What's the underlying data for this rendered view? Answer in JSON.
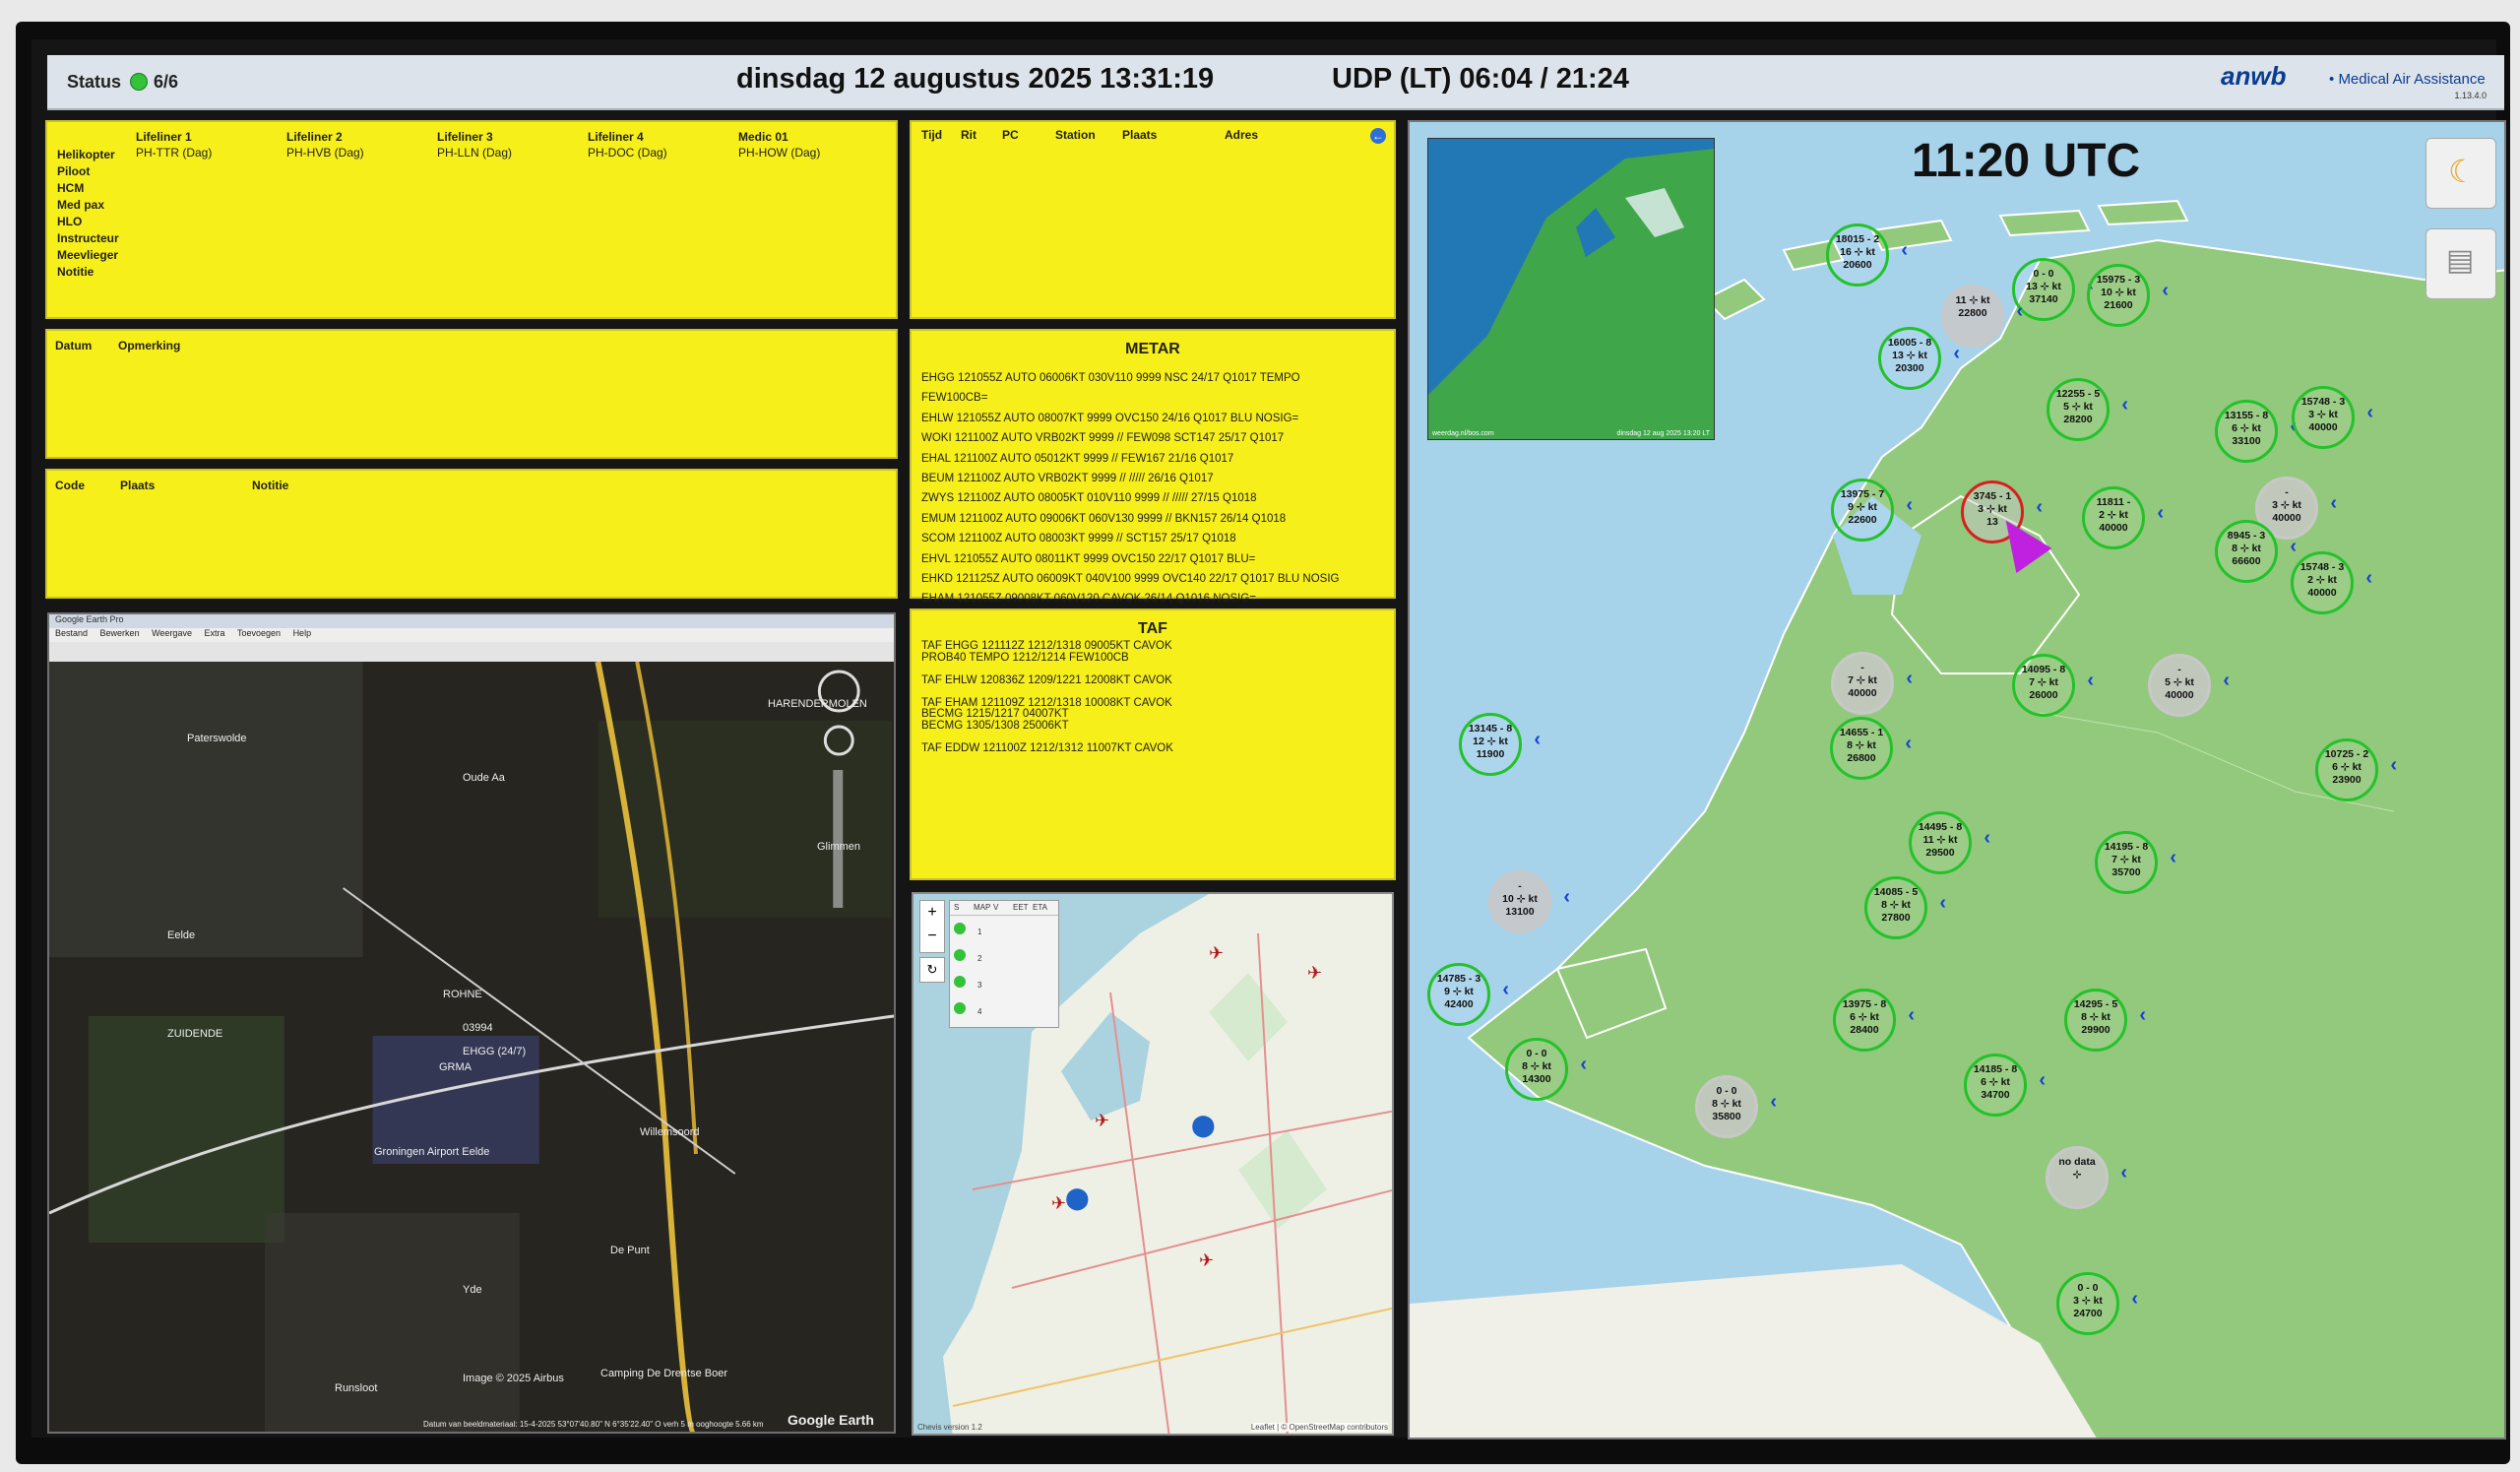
{
  "header": {
    "status_label": "Status",
    "status_value": "6/6",
    "datetime": "dinsdag 12 augustus 2025 13:31:19",
    "udp": "UDP (LT) 06:04 / 21:24",
    "brand": "anwb",
    "brand_separator": "•",
    "brand_text": "Medical Air Assistance",
    "brand_version": "1.13.4.0"
  },
  "crew": {
    "row_labels": [
      "Helikopter",
      "Piloot",
      "HCM",
      "Med pax",
      "HLO",
      "Instructeur",
      "Meevlieger",
      "Notitie"
    ],
    "columns": [
      {
        "name": "Lifeliner 1",
        "reg": "PH-TTR (Dag)"
      },
      {
        "name": "Lifeliner 2",
        "reg": "PH-HVB (Dag)"
      },
      {
        "name": "Lifeliner 3",
        "reg": "PH-LLN (Dag)"
      },
      {
        "name": "Lifeliner 4",
        "reg": "PH-DOC (Dag)"
      },
      {
        "name": "Medic 01",
        "reg": "PH-HOW (Dag)"
      }
    ]
  },
  "remarks": {
    "headers": [
      "Datum",
      "Opmerking"
    ]
  },
  "codes": {
    "headers": [
      "Code",
      "Plaats",
      "Notitie"
    ]
  },
  "missions": {
    "headers": [
      "Tijd",
      "Rit",
      "PC",
      "Station",
      "Plaats",
      "Adres"
    ]
  },
  "metar": {
    "title": "METAR",
    "lines": [
      "EHGG 121055Z AUTO 06006KT 030V110 9999 NSC 24/17 Q1017 TEMPO",
      "FEW100CB=",
      "EHLW 121055Z AUTO 08007KT 9999 OVC150 24/16 Q1017 BLU NOSIG=",
      "WOKI 121100Z AUTO VRB02KT 9999 // FEW098 SCT147 25/17 Q1017",
      "EHAL 121100Z AUTO 05012KT 9999 // FEW167 21/16 Q1017",
      "BEUM 121100Z AUTO VRB02KT 9999 // ///// 26/16 Q1017",
      "ZWYS 121100Z AUTO 08005KT 010V110 9999 // ///// 27/15 Q1018",
      "EMUM 121100Z AUTO 09006KT 060V130 9999 // BKN157 26/14 Q1018",
      "SCOM 121100Z AUTO 08003KT 9999 // SCT157 25/17 Q1018",
      "EHVL 121055Z AUTO 08011KT 9999 OVC150 22/17 Q1017 BLU=",
      "EHKD 121125Z AUTO 06009KT 040V100 9999 OVC140 22/17 Q1017 BLU NOSIG",
      "EHAM 121055Z 09008KT 060V120 CAVOK 26/14 Q1016 NOSIG="
    ]
  },
  "taf": {
    "title": "TAF",
    "lines": [
      "TAF EHGG 121112Z 1212/1318 09005KT CAVOK",
      "PROB40 TEMPO 1212/1214 FEW100CB",
      "",
      "TAF EHLW 120836Z 1209/1221 12008KT CAVOK",
      "",
      "TAF EHAM 121109Z 1212/1318 10008KT CAVOK",
      "BECMG 1215/1217 04007KT",
      "BECMG 1305/1308 25006KT",
      "",
      "TAF EDDW 121100Z 1212/1312 11007KT CAVOK"
    ]
  },
  "google_earth": {
    "window_title": "Google Earth Pro",
    "menu": [
      "Bestand",
      "Bewerken",
      "Weergave",
      "Extra",
      "Toevoegen",
      "Help"
    ],
    "labels": [
      "HARENDERMOLEN",
      "Paterswolde",
      "Oude Aa",
      "Eelde",
      "ZUIDENDE",
      "ROHNE",
      "Groningen Airport Eelde",
      "Willemsoord",
      "De Punt",
      "Yde",
      "Runsloot",
      "Glimmen",
      "Camping De Drentse Boer",
      "03994",
      "EHGG (24/7)",
      "GRMA",
      "Image © 2025 Airbus",
      "Google Earth",
      "Datum van beeldmateriaal: 15-4-2025   53°07'40.80\" N   6°35'22.40\" O   verh   5 m   ooghoogte   5.66 km"
    ]
  },
  "osm": {
    "table_headers": [
      "S",
      "MAP",
      "V",
      "EET",
      "ETA"
    ],
    "rows": [
      "1",
      "2",
      "3",
      "4"
    ],
    "footer_left": "Chevis version 1.2",
    "footer_right": "Leaflet | © OpenStreetMap contributors"
  },
  "weather_map": {
    "time": "11:20 UTC",
    "sat_caption_left": "weerdag.nl/bos.com",
    "sat_caption_right": "dinsdag 12 aug 2025 13:20 LT",
    "stations": [
      {
        "l1": "18015 - 2",
        "l2": "16 ⊹ kt",
        "l3": "20600",
        "s": "g"
      },
      {
        "l1": "0 - 0",
        "l2": "13 ⊹ kt",
        "l3": "37140",
        "s": "g"
      },
      {
        "l1": "15975 - 3",
        "l2": "10 ⊹ kt",
        "l3": "21600",
        "s": "g"
      },
      {
        "l1": "11 ⊹ kt",
        "l2": "",
        "l3": "22800",
        "s": "grey"
      },
      {
        "l1": "16005 - 8",
        "l2": "13 ⊹ kt",
        "l3": "20300",
        "s": "g"
      },
      {
        "l1": "12255 - 5",
        "l2": "5 ⊹ kt",
        "l3": "28200",
        "s": "g"
      },
      {
        "l1": "13155 - 8",
        "l2": "6 ⊹ kt",
        "l3": "33100",
        "s": "g"
      },
      {
        "l1": "15748 - 3",
        "l2": "3 ⊹ kt",
        "l3": "40000",
        "s": "g"
      },
      {
        "l1": "13975 - 7",
        "l2": "9 ⊹ kt",
        "l3": "22600",
        "s": "g"
      },
      {
        "l1": "3745 - 1",
        "l2": "3 ⊹ kt",
        "l3": "13",
        "s": "red"
      },
      {
        "l1": "11811 -",
        "l2": "2 ⊹ kt",
        "l3": "40000",
        "s": "g"
      },
      {
        "l1": "-",
        "l2": "3 ⊹ kt",
        "l3": "40000",
        "s": "grey"
      },
      {
        "l1": "8945 - 3",
        "l2": "8 ⊹ kt",
        "l3": "66600",
        "s": "g"
      },
      {
        "l1": "15748 - 3",
        "l2": "2 ⊹ kt",
        "l3": "40000",
        "s": "g"
      },
      {
        "l1": "-",
        "l2": "7 ⊹ kt",
        "l3": "40000",
        "s": "grey"
      },
      {
        "l1": "14095 - 8",
        "l2": "7 ⊹ kt",
        "l3": "26000",
        "s": "g"
      },
      {
        "l1": "-",
        "l2": "5 ⊹ kt",
        "l3": "40000",
        "s": "grey"
      },
      {
        "l1": "13145 - 8",
        "l2": "12 ⊹ kt",
        "l3": "11900",
        "s": "g"
      },
      {
        "l1": "14655 - 1",
        "l2": "8 ⊹ kt",
        "l3": "26800",
        "s": "g"
      },
      {
        "l1": "10725 - 2",
        "l2": "6 ⊹ kt",
        "l3": "23900",
        "s": "g"
      },
      {
        "l1": "14495 - 8",
        "l2": "11 ⊹ kt",
        "l3": "29500",
        "s": "g"
      },
      {
        "l1": "14195 - 8",
        "l2": "7 ⊹ kt",
        "l3": "35700",
        "s": "g"
      },
      {
        "l1": "-",
        "l2": "10 ⊹ kt",
        "l3": "13100",
        "s": "grey"
      },
      {
        "l1": "14085 - 5",
        "l2": "8 ⊹ kt",
        "l3": "27800",
        "s": "g"
      },
      {
        "l1": "14785 - 3",
        "l2": "9 ⊹ kt",
        "l3": "42400",
        "s": "g"
      },
      {
        "l1": "13975 - 8",
        "l2": "6 ⊹ kt",
        "l3": "28400",
        "s": "g"
      },
      {
        "l1": "14295 - 5",
        "l2": "8 ⊹ kt",
        "l3": "29900",
        "s": "g"
      },
      {
        "l1": "0 - 0",
        "l2": "8 ⊹ kt",
        "l3": "14300",
        "s": "g"
      },
      {
        "l1": "0 - 0",
        "l2": "8 ⊹ kt",
        "l3": "35800",
        "s": "grey"
      },
      {
        "l1": "14185 - 8",
        "l2": "6 ⊹ kt",
        "l3": "34700",
        "s": "g"
      },
      {
        "l1": "no data",
        "l2": "⊹",
        "l3": "",
        "s": "grey"
      },
      {
        "l1": "0 - 0",
        "l2": "3 ⊹ kt",
        "l3": "24700",
        "s": "g"
      }
    ]
  },
  "colors": {
    "panel_yellow": "#f7ef1a",
    "land_green": "#93c97c",
    "sea_blue": "#a6d2ea",
    "station_ring": "#23c22b",
    "wind_arrow": "#1b3fd4"
  }
}
